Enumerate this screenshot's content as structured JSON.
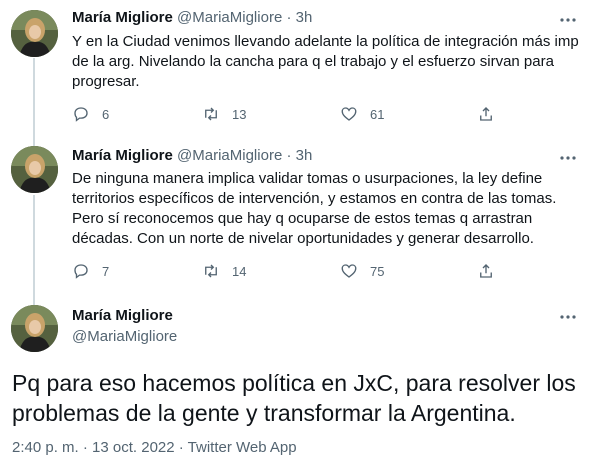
{
  "tweets": [
    {
      "name": "María Migliore",
      "handle": "@MariaMigliore",
      "sep": " · ",
      "time": "3h",
      "text": "Y en la Ciudad venimos llevando adelante la política de integración más imp\nde la arg. Nivelando la cancha para q el trabajo y el esfuerzo sirvan para\nprogresar.",
      "replies": "6",
      "retweets": "13",
      "likes": "61"
    },
    {
      "name": "María Migliore",
      "handle": "@MariaMigliore",
      "sep": " · ",
      "time": "3h",
      "text": "De ninguna manera implica validar tomas o usurpaciones, la ley define\nterritorios específicos de intervención, y estamos en contra de las tomas.\nPero sí reconocemos que hay q ocuparse de estos temas q arrastran\ndécadas. Con un norte de nivelar oportunidades y generar desarrollo.",
      "replies": "7",
      "retweets": "14",
      "likes": "75"
    }
  ],
  "main_tweet": {
    "name": "María Migliore",
    "handle": "@MariaMigliore",
    "text": "Pq para eso hacemos política en JxC, para resolver los\nproblemas de la gente y transformar la Argentina.",
    "meta": "2:40 p. m. · 13 oct. 2022 · Twitter Web App"
  },
  "icons": {
    "more": "more-horizontal-icon",
    "reply": "reply-icon",
    "retweet": "retweet-icon",
    "like": "heart-icon",
    "share": "share-icon"
  },
  "colors": {
    "text": "#0f1419",
    "secondary": "#536471",
    "thread_line": "#cfd9de",
    "divider": "#eff3f4"
  }
}
